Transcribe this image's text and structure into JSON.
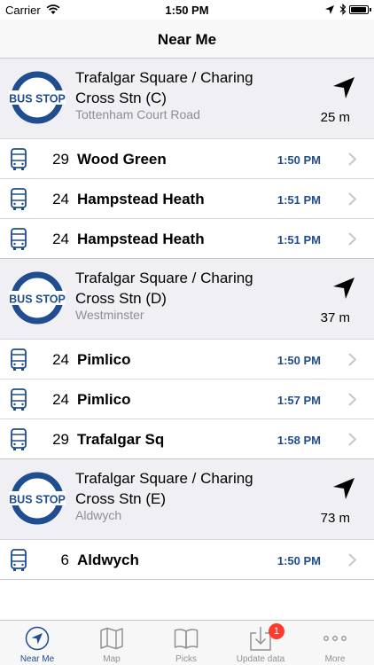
{
  "status_bar": {
    "carrier": "Carrier",
    "time": "1:50 PM"
  },
  "nav": {
    "title": "Near Me"
  },
  "logo": {
    "text": "BUS STOP",
    "color": "#1f4d8f"
  },
  "stops": [
    {
      "name": "Trafalgar Square / Charing Cross Stn (C)",
      "street": "Tottenham Court Road",
      "distance": "25 m",
      "departures": [
        {
          "route": "29",
          "destination": "Wood Green",
          "time": "1:50 PM"
        },
        {
          "route": "24",
          "destination": "Hampstead Heath",
          "time": "1:51 PM"
        },
        {
          "route": "24",
          "destination": "Hampstead Heath",
          "time": "1:51 PM"
        }
      ]
    },
    {
      "name": "Trafalgar Square / Charing Cross Stn (D)",
      "street": "Westminster",
      "distance": "37 m",
      "departures": [
        {
          "route": "24",
          "destination": "Pimlico",
          "time": "1:50 PM"
        },
        {
          "route": "24",
          "destination": "Pimlico",
          "time": "1:57 PM"
        },
        {
          "route": "29",
          "destination": "Trafalgar Sq",
          "time": "1:58 PM"
        }
      ]
    },
    {
      "name": "Trafalgar Square / Charing Cross Stn (E)",
      "street": "Aldwych",
      "distance": "73 m",
      "departures": [
        {
          "route": "6",
          "destination": "Aldwych",
          "time": "1:50 PM"
        }
      ]
    }
  ],
  "tabs": [
    {
      "label": "Near Me",
      "icon": "location-arrow-icon",
      "active": true
    },
    {
      "label": "Map",
      "icon": "map-icon",
      "active": false
    },
    {
      "label": "Picks",
      "icon": "book-icon",
      "active": false
    },
    {
      "label": "Update data",
      "icon": "download-icon",
      "active": false,
      "badge": "1"
    },
    {
      "label": "More",
      "icon": "more-icon",
      "active": false
    }
  ],
  "colors": {
    "accent": "#1f4d8f",
    "secondary_text": "#8e8e93",
    "header_bg": "#efeff4",
    "badge": "#ff3b30"
  }
}
